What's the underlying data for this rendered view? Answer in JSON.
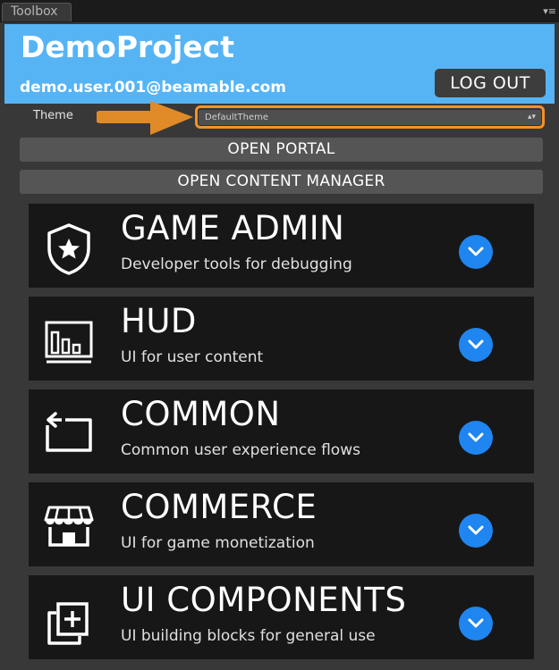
{
  "window": {
    "tab_title": "Toolbox",
    "menu_icon": "tab-menu-icon"
  },
  "header": {
    "project_name": "DemoProject",
    "user_email": "demo.user.001@beamable.com",
    "logout_label": "LOG OUT",
    "background_color": "#56b4f5"
  },
  "theme": {
    "label": "Theme",
    "selected": "DefaultTheme",
    "highlight_color": "#f29326"
  },
  "buttons": {
    "open_portal": "OPEN PORTAL",
    "open_content_manager": "OPEN CONTENT MANAGER"
  },
  "sections": [
    {
      "title": "GAME ADMIN",
      "description": "Developer tools for debugging",
      "icon": "shield-star-icon"
    },
    {
      "title": "HUD",
      "description": "UI for user content",
      "icon": "hud-bars-icon"
    },
    {
      "title": "COMMON",
      "description": "Common user experience flows",
      "icon": "return-frame-icon"
    },
    {
      "title": "COMMERCE",
      "description": "UI for game monetization",
      "icon": "storefront-icon"
    },
    {
      "title": "UI COMPONENTS",
      "description": "UI building blocks for general use",
      "icon": "add-layers-icon"
    }
  ],
  "colors": {
    "expand_button": "#1f85f0",
    "card_background": "#171717",
    "panel_background": "#383838"
  }
}
